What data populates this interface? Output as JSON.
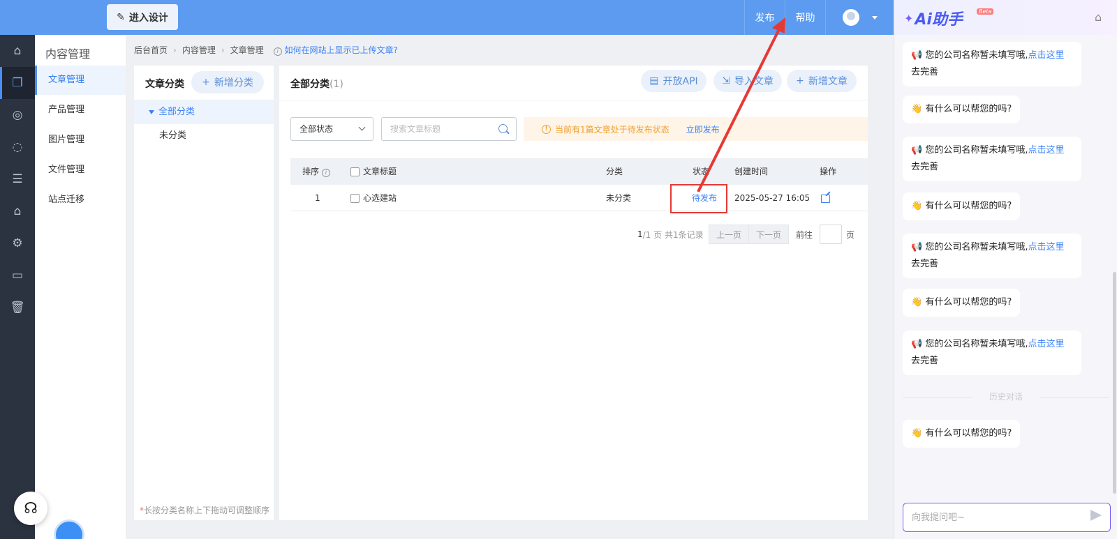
{
  "topbar": {
    "design_label": "进入设计",
    "publish_label": "发布",
    "help_label": "帮助"
  },
  "rail": {
    "icons": [
      "home-icon",
      "documents-icon",
      "planet-icon",
      "chat-icon",
      "list-icon",
      "bag-icon",
      "gear-icon",
      "terminal-icon",
      "trash-icon"
    ],
    "active_index": 1
  },
  "sidebar": {
    "title": "内容管理",
    "items": [
      {
        "label": "文章管理",
        "active": true
      },
      {
        "label": "产品管理"
      },
      {
        "label": "图片管理"
      },
      {
        "label": "文件管理"
      },
      {
        "label": "站点迁移"
      }
    ]
  },
  "breadcrumb": {
    "items": [
      "后台首页",
      "内容管理",
      "文章管理"
    ],
    "help_link": "如何在网站上显示已上传文章?"
  },
  "categories": {
    "title": "文章分类",
    "add_label": "新增分类",
    "items": [
      {
        "label": "全部分类",
        "active": true
      },
      {
        "label": "未分类"
      }
    ],
    "footer_star": "*",
    "footer": "长按分类名称上下拖动可调整顺序"
  },
  "main": {
    "title": "全部分类",
    "count": "(1)",
    "actions": {
      "api_label": "开放API",
      "import_label": "导入文章",
      "add_label": "新增文章"
    },
    "filter": {
      "status_value": "全部状态",
      "search_placeholder": "搜索文章标题"
    },
    "notice": {
      "text": "当前有1篇文章处于待发布状态",
      "action": "立即发布"
    },
    "table": {
      "headers": {
        "order": "排序",
        "title": "文章标题",
        "category": "分类",
        "status": "状态",
        "created": "创建时间",
        "ops": "操作"
      },
      "rows": [
        {
          "order": "1",
          "title": "心选建站",
          "category": "未分类",
          "status": "待发布",
          "created": "2025-05-27 16:05"
        }
      ]
    },
    "pager": {
      "current": "1",
      "total": "/1 页 共1条记录",
      "prev": "上一页",
      "next": "下一页",
      "goto": "前往",
      "page_unit": "页"
    }
  },
  "ai": {
    "logo_text": "Ai助手",
    "beta": "Beta",
    "messages": [
      {
        "emoji": "📢",
        "text": "您的公司名称暂未填写哦,",
        "link": "点击这里",
        "tail": "去完善"
      },
      {
        "emoji": "👋",
        "text": "有什么可以帮您的吗?"
      },
      {
        "emoji": "📢",
        "text": "您的公司名称暂未填写哦,",
        "link": "点击这里",
        "tail": "去完善"
      },
      {
        "emoji": "👋",
        "text": "有什么可以帮您的吗?"
      },
      {
        "emoji": "📢",
        "text": "您的公司名称暂未填写哦,",
        "link": "点击这里",
        "tail": "去完善"
      },
      {
        "emoji": "👋",
        "text": "有什么可以帮您的吗?"
      },
      {
        "emoji": "📢",
        "text": "您的公司名称暂未填写哦,",
        "link": "点击这里",
        "tail": "去完善"
      }
    ],
    "history_label": "历史对话",
    "history_messages": [
      {
        "emoji": "👋",
        "text": "有什么可以帮您的吗?"
      }
    ],
    "input_placeholder": "向我提问吧~"
  },
  "colors": {
    "topbar": "#5c9bf0",
    "rail": "#2b3240",
    "accent": "#3b82f6",
    "annotation": "#e53935"
  }
}
